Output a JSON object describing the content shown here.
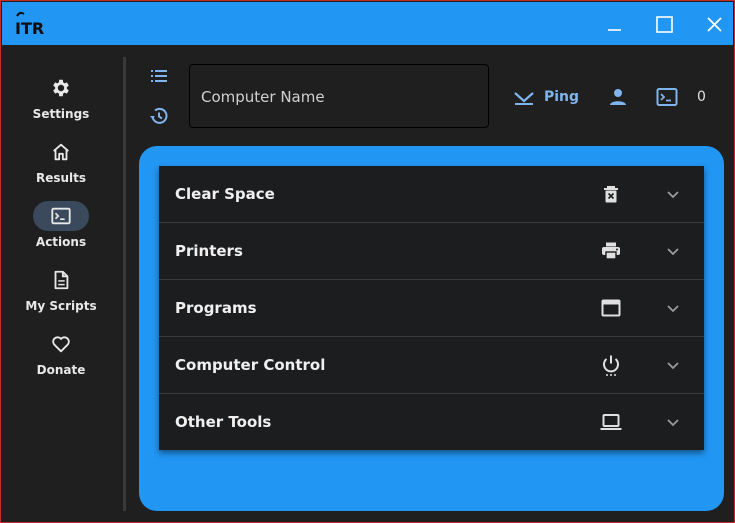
{
  "titlebar": {
    "logo_text": "ITR",
    "minimize_label": "Minimize",
    "maximize_label": "Maximize",
    "close_label": "Close"
  },
  "sidebar": {
    "items": [
      {
        "label": "Settings",
        "icon": "gear-icon",
        "active": false
      },
      {
        "label": "Results",
        "icon": "home-icon",
        "active": false
      },
      {
        "label": "Actions",
        "icon": "terminal-icon",
        "active": true
      },
      {
        "label": "My Scripts",
        "icon": "document-icon",
        "active": false
      },
      {
        "label": "Donate",
        "icon": "heart-icon",
        "active": false
      }
    ]
  },
  "toolbar": {
    "computer_name_placeholder": "Computer Name",
    "computer_name_value": "",
    "ping_label": "Ping",
    "terminal_count": "0"
  },
  "actions": [
    {
      "title": "Clear Space",
      "icon": "trash-icon"
    },
    {
      "title": "Printers",
      "icon": "printer-icon"
    },
    {
      "title": "Programs",
      "icon": "window-icon"
    },
    {
      "title": "Computer Control",
      "icon": "power-icon"
    },
    {
      "title": "Other Tools",
      "icon": "laptop-icon"
    }
  ],
  "colors": {
    "accent": "#2196f3",
    "window_border": "#c42b2b",
    "background": "#1f1f1f",
    "ping_text": "#7fb4ec",
    "active_nav": "#3a4a5c"
  }
}
